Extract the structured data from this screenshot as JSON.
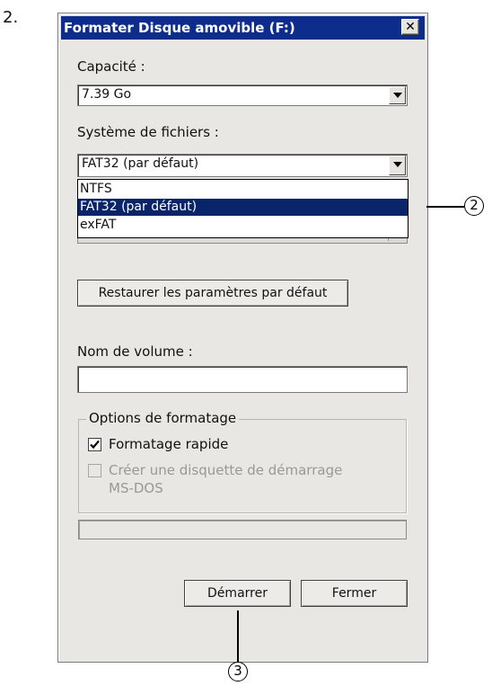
{
  "step_number": "2.",
  "dialog": {
    "title": "Formater Disque amovible (F:)",
    "close_icon": "close-icon",
    "close_glyph": "✕"
  },
  "capacity": {
    "label": "Capacité :",
    "value": "7.39 Go"
  },
  "file_system": {
    "label": "Système de fichiers :",
    "value": "FAT32 (par défaut)",
    "options": [
      "NTFS",
      "FAT32 (par défaut)",
      "exFAT"
    ],
    "selected_index": 1
  },
  "restore_defaults_label": "Restaurer les paramètres par défaut",
  "volume_name": {
    "label": "Nom de volume :",
    "value": ""
  },
  "format_options": {
    "legend": "Options de formatage",
    "quick_format": {
      "label": "Formatage rapide",
      "checked": true
    },
    "msdos_startup": {
      "label_line1": "Créer une disquette de démarrage",
      "label_line2": "MS-DOS",
      "checked": false,
      "disabled": true
    }
  },
  "progress": {
    "value": 0
  },
  "buttons": {
    "start": "Démarrer",
    "close": "Fermer"
  },
  "callouts": {
    "dropdown_callout": "2",
    "start_callout": "3"
  },
  "colors": {
    "titlebar": "#0c2d8c",
    "selection": "#0a246a",
    "dialog_bg": "#e9e7e3"
  }
}
